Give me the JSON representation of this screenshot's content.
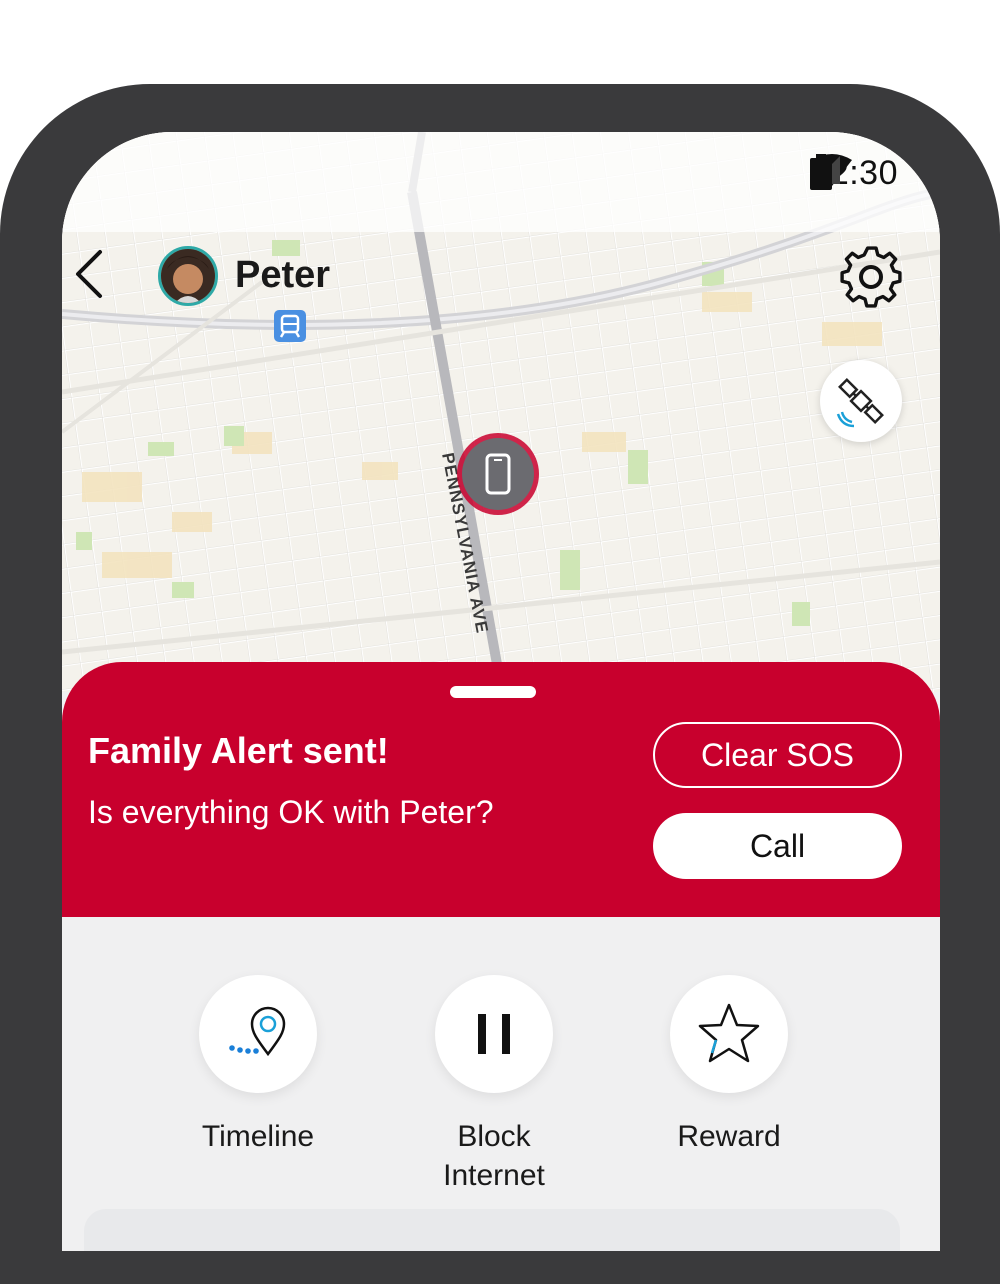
{
  "status_bar": {
    "time": "12:30",
    "icons": [
      "wifi-icon",
      "signal-icon",
      "battery-icon"
    ]
  },
  "header": {
    "child_name": "Peter",
    "back_icon": "chevron-left-icon",
    "settings_icon": "gear-icon"
  },
  "map": {
    "street_label": "PENNSYLVANIA AVE",
    "satellite_icon": "satellite-icon",
    "transit_icon": "train-icon",
    "device_icon": "phone-icon"
  },
  "alert": {
    "title": "Family Alert sent!",
    "message": "Is everything OK with Peter?",
    "clear_sos_label": "Clear SOS",
    "call_label": "Call",
    "color": "#c8002d"
  },
  "actions": [
    {
      "label": "Timeline",
      "icon": "location-pin-icon"
    },
    {
      "label": "Block Internet",
      "icon": "pause-icon"
    },
    {
      "label": "Reward",
      "icon": "star-icon"
    }
  ]
}
